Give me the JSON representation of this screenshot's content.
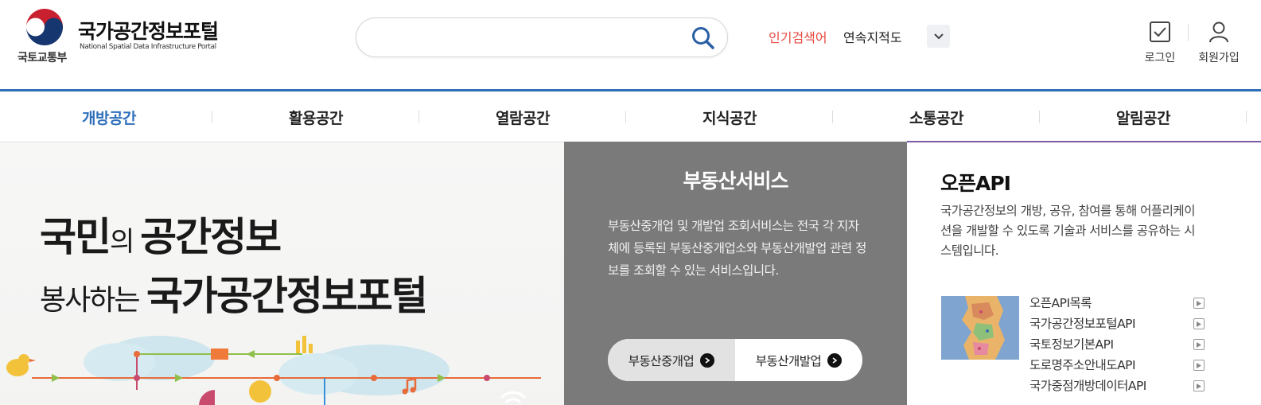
{
  "header": {
    "ministry": "국토교통부",
    "portal_title": "국가공간정보포털",
    "portal_subtitle": "National Spatial Data Infrastructure Portal",
    "search": {
      "value": "",
      "placeholder": ""
    },
    "popular_label": "인기검색어",
    "popular_term": "연속지적도",
    "login_label": "로그인",
    "join_label": "회원가입"
  },
  "nav": {
    "items": [
      {
        "label": "개방공간",
        "active": true
      },
      {
        "label": "활용공간"
      },
      {
        "label": "열람공간"
      },
      {
        "label": "지식공간"
      },
      {
        "label": "소통공간"
      },
      {
        "label": "알림공간"
      }
    ]
  },
  "hero": {
    "line1_a": "국민",
    "line1_b": "의 ",
    "line1_c": "공간정보",
    "line2_a": "봉사하는 ",
    "line2_b": "국가공간정보포털"
  },
  "real_estate": {
    "title": "부동산서비스",
    "description": "부동산중개업 및 개발업 조회서비스는 전국 각 지자체에 등록된 부동산중개업소와 부동산개발업 관련 정보를 조회할 수 있는 서비스입니다.",
    "button_1": "부동산중개업",
    "button_2": "부동산개발업"
  },
  "open_api": {
    "title": "오픈API",
    "description": "국가공간정보의 개방, 공유, 참여를 통해 어플리케이션을 개발할 수 있도록 기술과 서비스를 공유하는 시스템입니다.",
    "links": [
      "오픈API목록",
      "국가공간정보포털API",
      "국토정보기본API",
      "도로명주소안내도API",
      "국가중점개방데이터API"
    ]
  },
  "colors": {
    "accent_blue": "#2f6fba",
    "popular_red": "#e8473e",
    "panel_gray": "#7a7a7a",
    "api_border": "#7a5ba6"
  }
}
